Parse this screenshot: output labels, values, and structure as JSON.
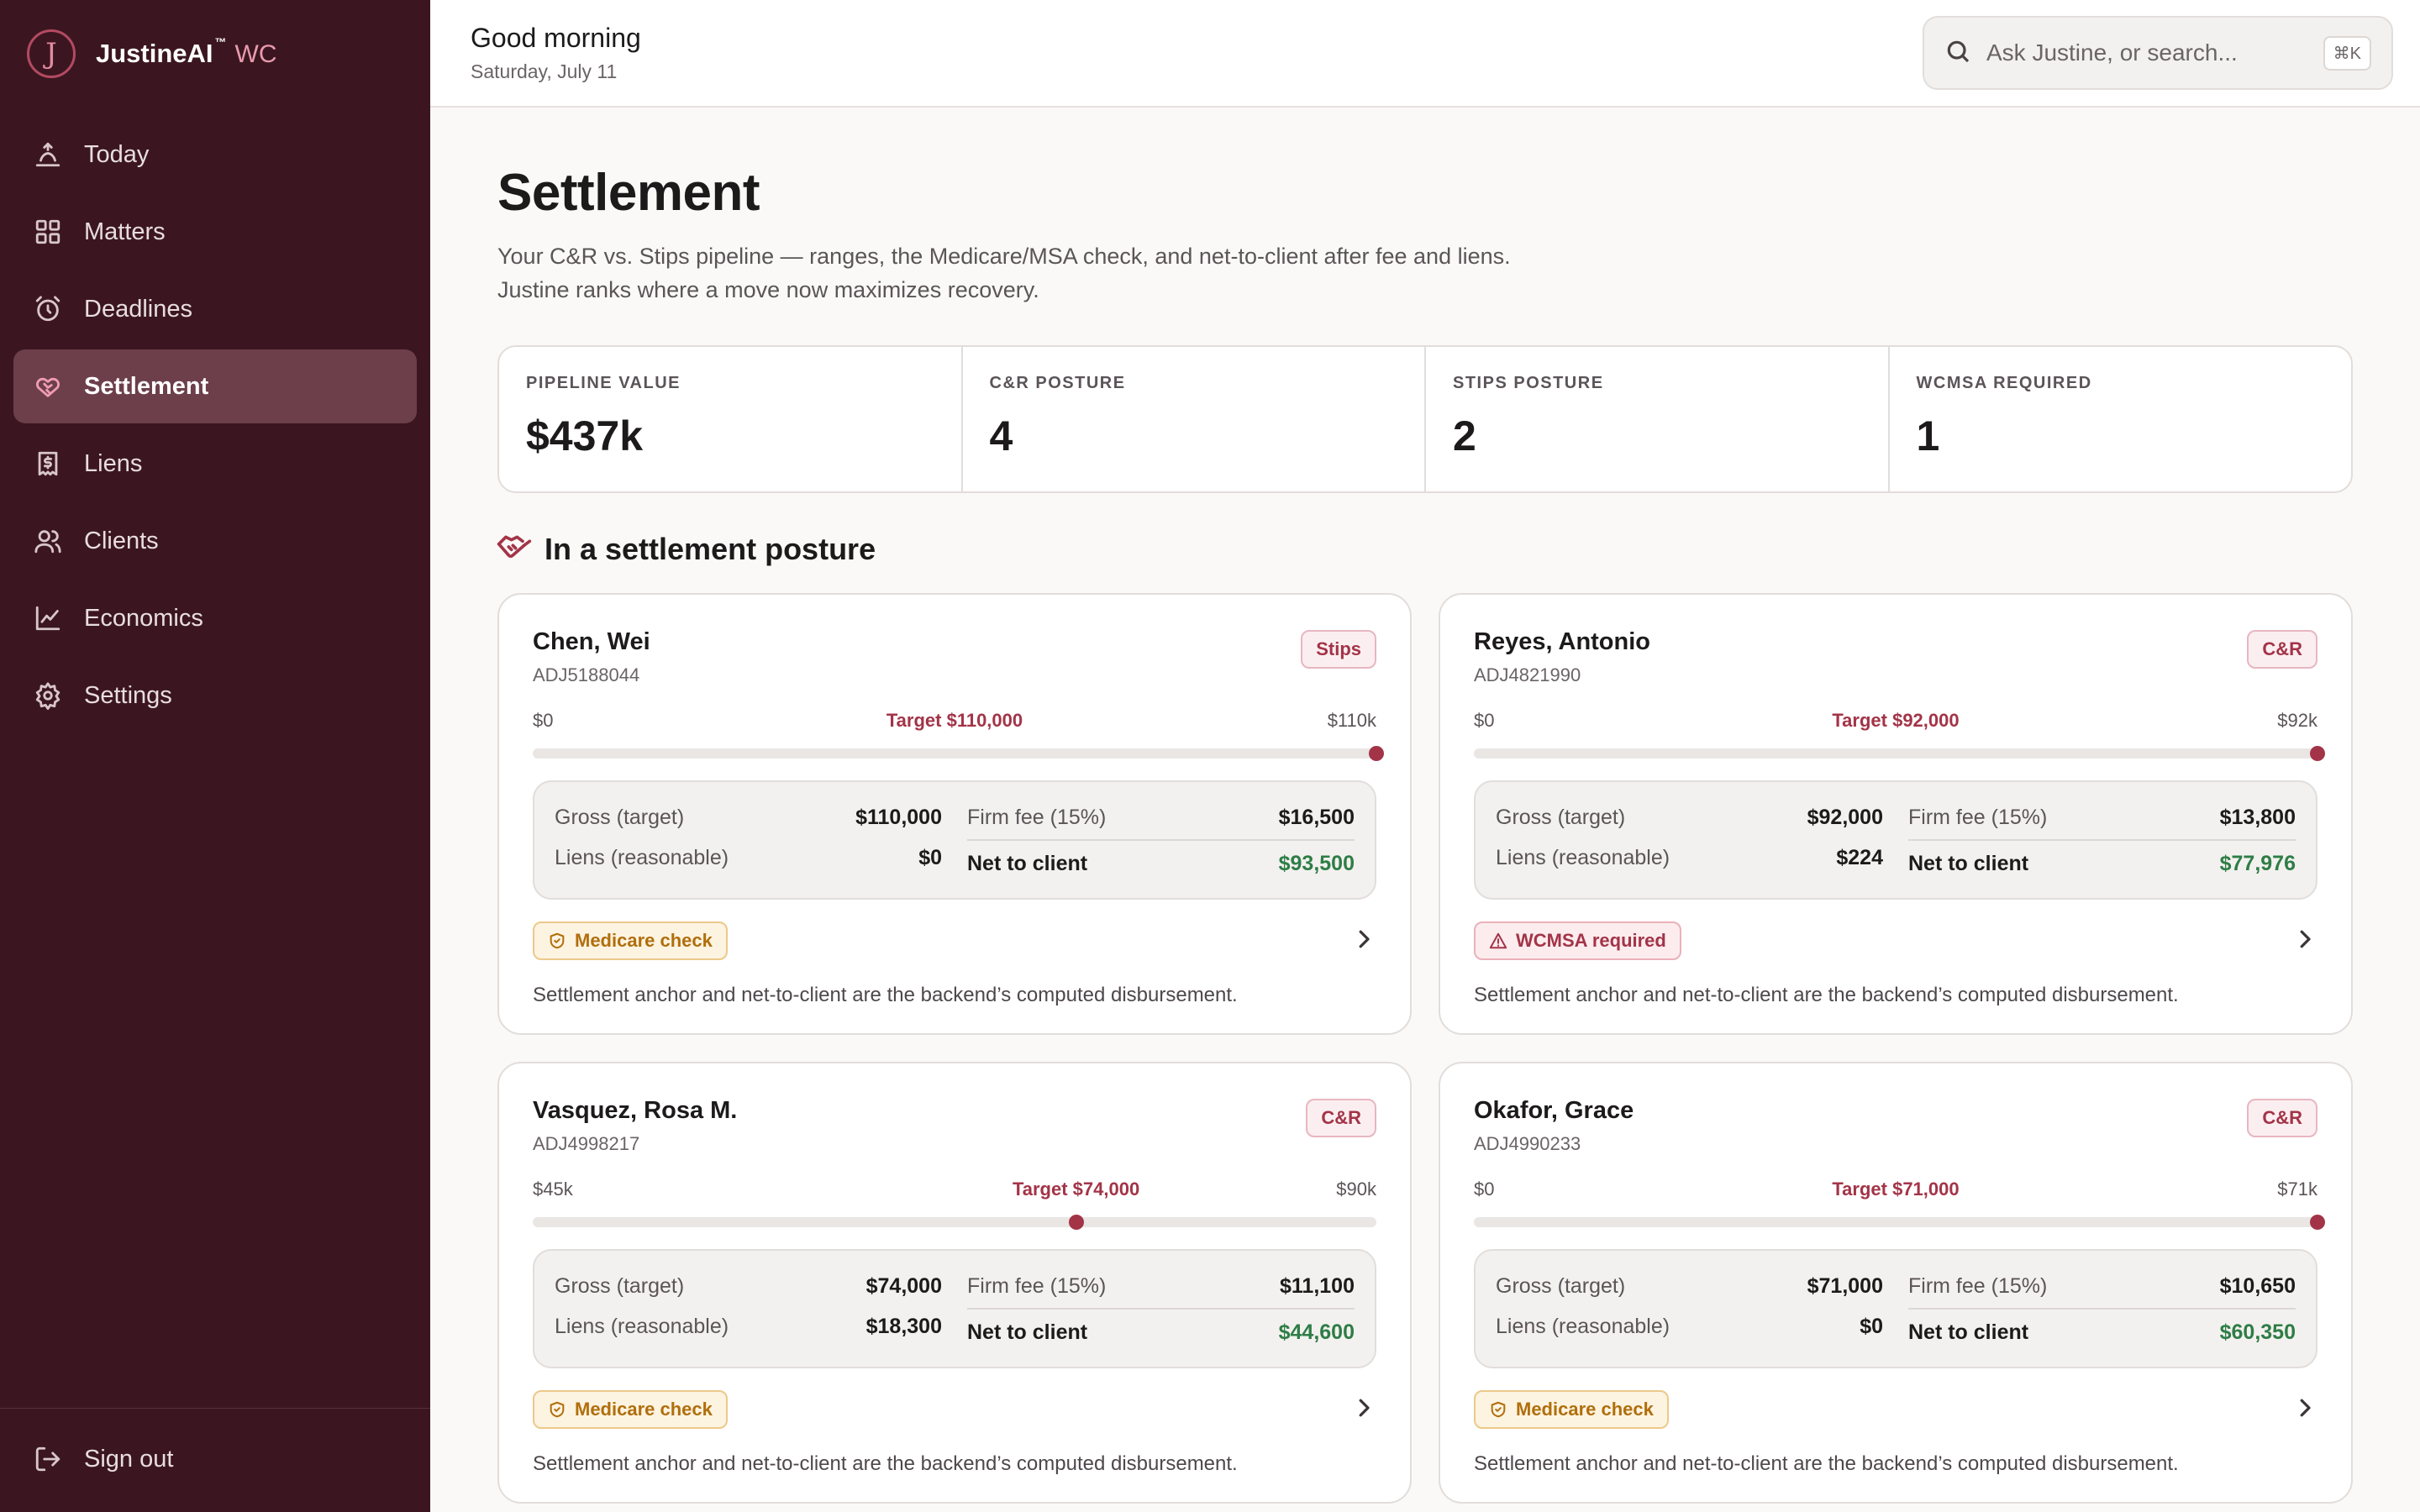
{
  "brand": {
    "logo_letter": "J",
    "name": "JustineAI",
    "tm": "™",
    "product": "WC"
  },
  "nav": [
    {
      "key": "today",
      "label": "Today",
      "icon": "today-icon",
      "active": false
    },
    {
      "key": "matters",
      "label": "Matters",
      "icon": "grid-icon",
      "active": false
    },
    {
      "key": "deadlines",
      "label": "Deadlines",
      "icon": "alarm-clock-icon",
      "active": false
    },
    {
      "key": "settlement",
      "label": "Settlement",
      "icon": "handshake-icon",
      "active": true
    },
    {
      "key": "liens",
      "label": "Liens",
      "icon": "receipt-dollar-icon",
      "active": false
    },
    {
      "key": "clients",
      "label": "Clients",
      "icon": "users-icon",
      "active": false
    },
    {
      "key": "economics",
      "label": "Economics",
      "icon": "line-chart-icon",
      "active": false
    },
    {
      "key": "settings",
      "label": "Settings",
      "icon": "gear-icon",
      "active": false
    }
  ],
  "signout": {
    "label": "Sign out",
    "icon": "sign-out-icon"
  },
  "header": {
    "greeting": "Good morning",
    "date": "Saturday, July 11"
  },
  "search": {
    "placeholder": "Ask Justine, or search...",
    "shortcut": "⌘K"
  },
  "page": {
    "title": "Settlement",
    "subtitle_line1": "Your C&R vs. Stips pipeline — ranges, the Medicare/MSA check, and net-to-client after fee and liens.",
    "subtitle_line2": "Justine ranks where a move now maximizes recovery."
  },
  "stats": [
    {
      "label": "PIPELINE VALUE",
      "value": "$437k"
    },
    {
      "label": "C&R POSTURE",
      "value": "4"
    },
    {
      "label": "STIPS POSTURE",
      "value": "2"
    },
    {
      "label": "WCMSA REQUIRED",
      "value": "1"
    }
  ],
  "section": {
    "title": "In a settlement posture"
  },
  "labels": {
    "gross": "Gross (target)",
    "liens": "Liens (reasonable)",
    "fee": "Firm fee (15%)",
    "net": "Net to client",
    "note": "Settlement anchor and net-to-client are the backend’s computed disbursement."
  },
  "cards": [
    {
      "name": "Chen, Wei",
      "adj": "ADJ5188044",
      "posture": "Stips",
      "range_min": "$0",
      "range_max": "$110k",
      "target_label": "Target $110,000",
      "target_fraction": 1.0,
      "gross": "$110,000",
      "liens": "$0",
      "fee": "$16,500",
      "net": "$93,500",
      "badge": {
        "label": "Medicare check",
        "kind": "amber",
        "icon": "shield-check-icon"
      }
    },
    {
      "name": "Reyes, Antonio",
      "adj": "ADJ4821990",
      "posture": "C&R",
      "range_min": "$0",
      "range_max": "$92k",
      "target_label": "Target $92,000",
      "target_fraction": 1.0,
      "gross": "$92,000",
      "liens": "$224",
      "fee": "$13,800",
      "net": "$77,976",
      "badge": {
        "label": "WCMSA required",
        "kind": "red",
        "icon": "warning-icon"
      }
    },
    {
      "name": "Vasquez, Rosa M.",
      "adj": "ADJ4998217",
      "posture": "C&R",
      "range_min": "$45k",
      "range_max": "$90k",
      "target_label": "Target $74,000",
      "target_fraction": 0.644,
      "gross": "$74,000",
      "liens": "$18,300",
      "fee": "$11,100",
      "net": "$44,600",
      "badge": {
        "label": "Medicare check",
        "kind": "amber",
        "icon": "shield-check-icon"
      }
    },
    {
      "name": "Okafor, Grace",
      "adj": "ADJ4990233",
      "posture": "C&R",
      "range_min": "$0",
      "range_max": "$71k",
      "target_label": "Target $71,000",
      "target_fraction": 1.0,
      "gross": "$71,000",
      "liens": "$0",
      "fee": "$10,650",
      "net": "$60,350",
      "badge": {
        "label": "Medicare check",
        "kind": "amber",
        "icon": "shield-check-icon"
      }
    }
  ]
}
